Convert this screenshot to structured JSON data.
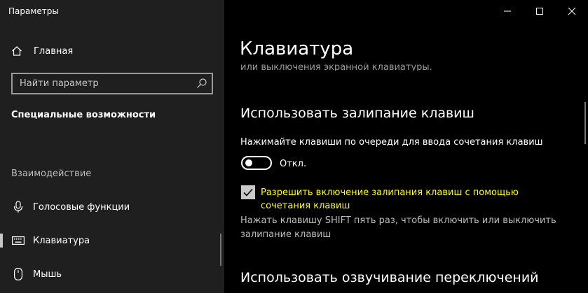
{
  "window": {
    "title": "Параметры"
  },
  "sidebar": {
    "home_label": "Главная",
    "search": {
      "placeholder": "Найти параметр",
      "value": ""
    },
    "section_title": "Специальные возможности",
    "group_title": "Взаимодействие",
    "items": [
      {
        "label": "Голосовые функции",
        "icon": "microphone-icon"
      },
      {
        "label": "Клавиатура",
        "icon": "keyboard-icon",
        "active": true
      },
      {
        "label": "Мышь",
        "icon": "mouse-icon"
      }
    ]
  },
  "main": {
    "page_title": "Клавиатура",
    "cut_text": "или выключения экранной клавиатуры.",
    "sticky_keys": {
      "heading": "Использовать залипание клавиш",
      "description": "Нажимайте клавиши по очереди для ввода сочетания клавиш",
      "toggle_state": "Откл.",
      "toggle_on": false,
      "checkbox_label": "Разрешить включение залипания клавиш с помощью сочетания клавиш",
      "checkbox_checked": true,
      "help_text": "Нажать клавишу SHIFT пять раз, чтобы включить или выключить залипание клавиш"
    },
    "toggle_keys": {
      "heading": "Использовать озвучивание переключений"
    }
  },
  "colors": {
    "sidebar_bg": "#1f1f1f",
    "main_bg": "#000000",
    "highlight_text": "#ffff00"
  }
}
